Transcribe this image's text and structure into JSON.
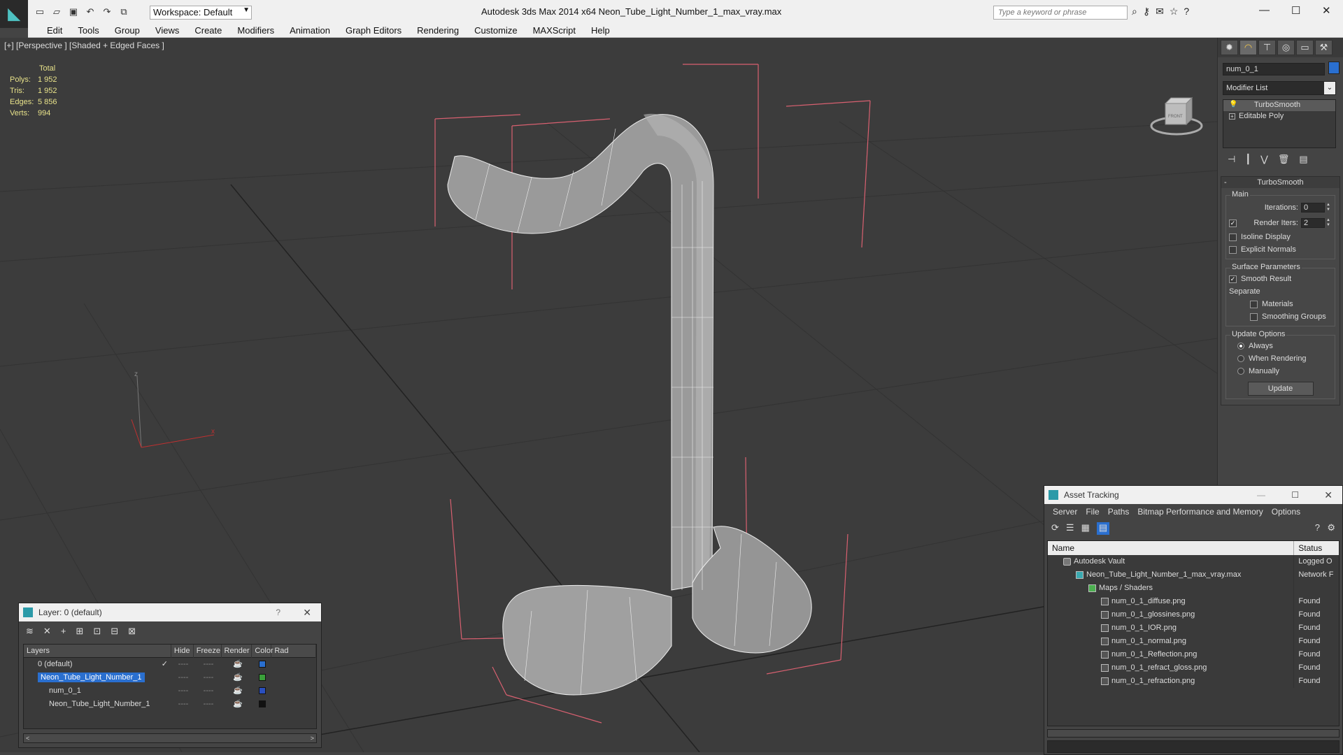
{
  "title_bar": {
    "logo_icon": "3dsmax-logo-icon",
    "workspace": "Workspace: Default",
    "title": "Autodesk 3ds Max  2014 x64      Neon_Tube_Light_Number_1_max_vray.max",
    "search_placeholder": "Type a keyword or phrase",
    "window_controls": [
      "—",
      "☐",
      "✕"
    ]
  },
  "menu": [
    "Edit",
    "Tools",
    "Group",
    "Views",
    "Create",
    "Modifiers",
    "Animation",
    "Graph Editors",
    "Rendering",
    "Customize",
    "MAXScript",
    "Help"
  ],
  "viewport": {
    "label": "[+] [Perspective ] [Shaded + Edged Faces ]",
    "stats_header": "Total",
    "stats": [
      {
        "k": "Polys:",
        "v": "1 952"
      },
      {
        "k": "Tris:",
        "v": "1 952"
      },
      {
        "k": "Edges:",
        "v": "5 856"
      },
      {
        "k": "Verts:",
        "v": "994"
      }
    ],
    "viewcube_label": "FRONT",
    "axis_x": "x",
    "axis_z": "z"
  },
  "command_panel": {
    "object_name": "num_0_1",
    "object_color": "#2a6fcf",
    "modifier_list": "Modifier List",
    "stack": [
      "TurboSmooth",
      "Editable Poly"
    ],
    "rollout_title": "TurboSmooth",
    "main_group": "Main",
    "iterations_label": "Iterations:",
    "iterations_value": "0",
    "render_iters_label": "Render Iters:",
    "render_iters_value": "2",
    "isoline_label": "Isoline Display",
    "explicit_normals_label": "Explicit Normals",
    "surface_group": "Surface Parameters",
    "smooth_result_label": "Smooth Result",
    "separate_label": "Separate",
    "materials_label": "Materials",
    "smoothing_groups_label": "Smoothing Groups",
    "update_group": "Update Options",
    "always_label": "Always",
    "when_rendering_label": "When Rendering",
    "manually_label": "Manually",
    "update_button": "Update"
  },
  "layer_dialog": {
    "title": "Layer: 0 (default)",
    "help": "?",
    "close": "✕",
    "columns": [
      "Layers",
      "Hide",
      "Freeze",
      "Render",
      "Color",
      "Rad"
    ],
    "rows": [
      {
        "name": "0 (default)",
        "color": "#2a6fcf",
        "selected": false
      },
      {
        "name": "Neon_Tube_Light_Number_1",
        "color": "#3aa03a",
        "selected": true
      },
      {
        "name": "num_0_1",
        "color": "#2a4fbf",
        "selected": false
      },
      {
        "name": "Neon_Tube_Light_Number_1",
        "color": "#111111",
        "selected": false
      }
    ]
  },
  "asset_dialog": {
    "title": "Asset Tracking",
    "menu": [
      "Server",
      "File",
      "Paths",
      "Bitmap Performance and Memory",
      "Options"
    ],
    "col_name": "Name",
    "col_status": "Status",
    "rows": [
      {
        "name": "Autodesk Vault",
        "status": "Logged O",
        "indent": 1,
        "icon": "vault"
      },
      {
        "name": "Neon_Tube_Light_Number_1_max_vray.max",
        "status": "Network F",
        "indent": 2,
        "icon": "max"
      },
      {
        "name": "Maps / Shaders",
        "status": "",
        "indent": 3,
        "icon": "folder"
      },
      {
        "name": "num_0_1_diffuse.png",
        "status": "Found",
        "indent": 4,
        "icon": "img"
      },
      {
        "name": "num_0_1_glossines.png",
        "status": "Found",
        "indent": 4,
        "icon": "img"
      },
      {
        "name": "num_0_1_IOR.png",
        "status": "Found",
        "indent": 4,
        "icon": "img"
      },
      {
        "name": "num_0_1_normal.png",
        "status": "Found",
        "indent": 4,
        "icon": "img"
      },
      {
        "name": "num_0_1_Reflection.png",
        "status": "Found",
        "indent": 4,
        "icon": "img"
      },
      {
        "name": "num_0_1_refract_gloss.png",
        "status": "Found",
        "indent": 4,
        "icon": "img"
      },
      {
        "name": "num_0_1_refraction.png",
        "status": "Found",
        "indent": 4,
        "icon": "img"
      }
    ]
  }
}
